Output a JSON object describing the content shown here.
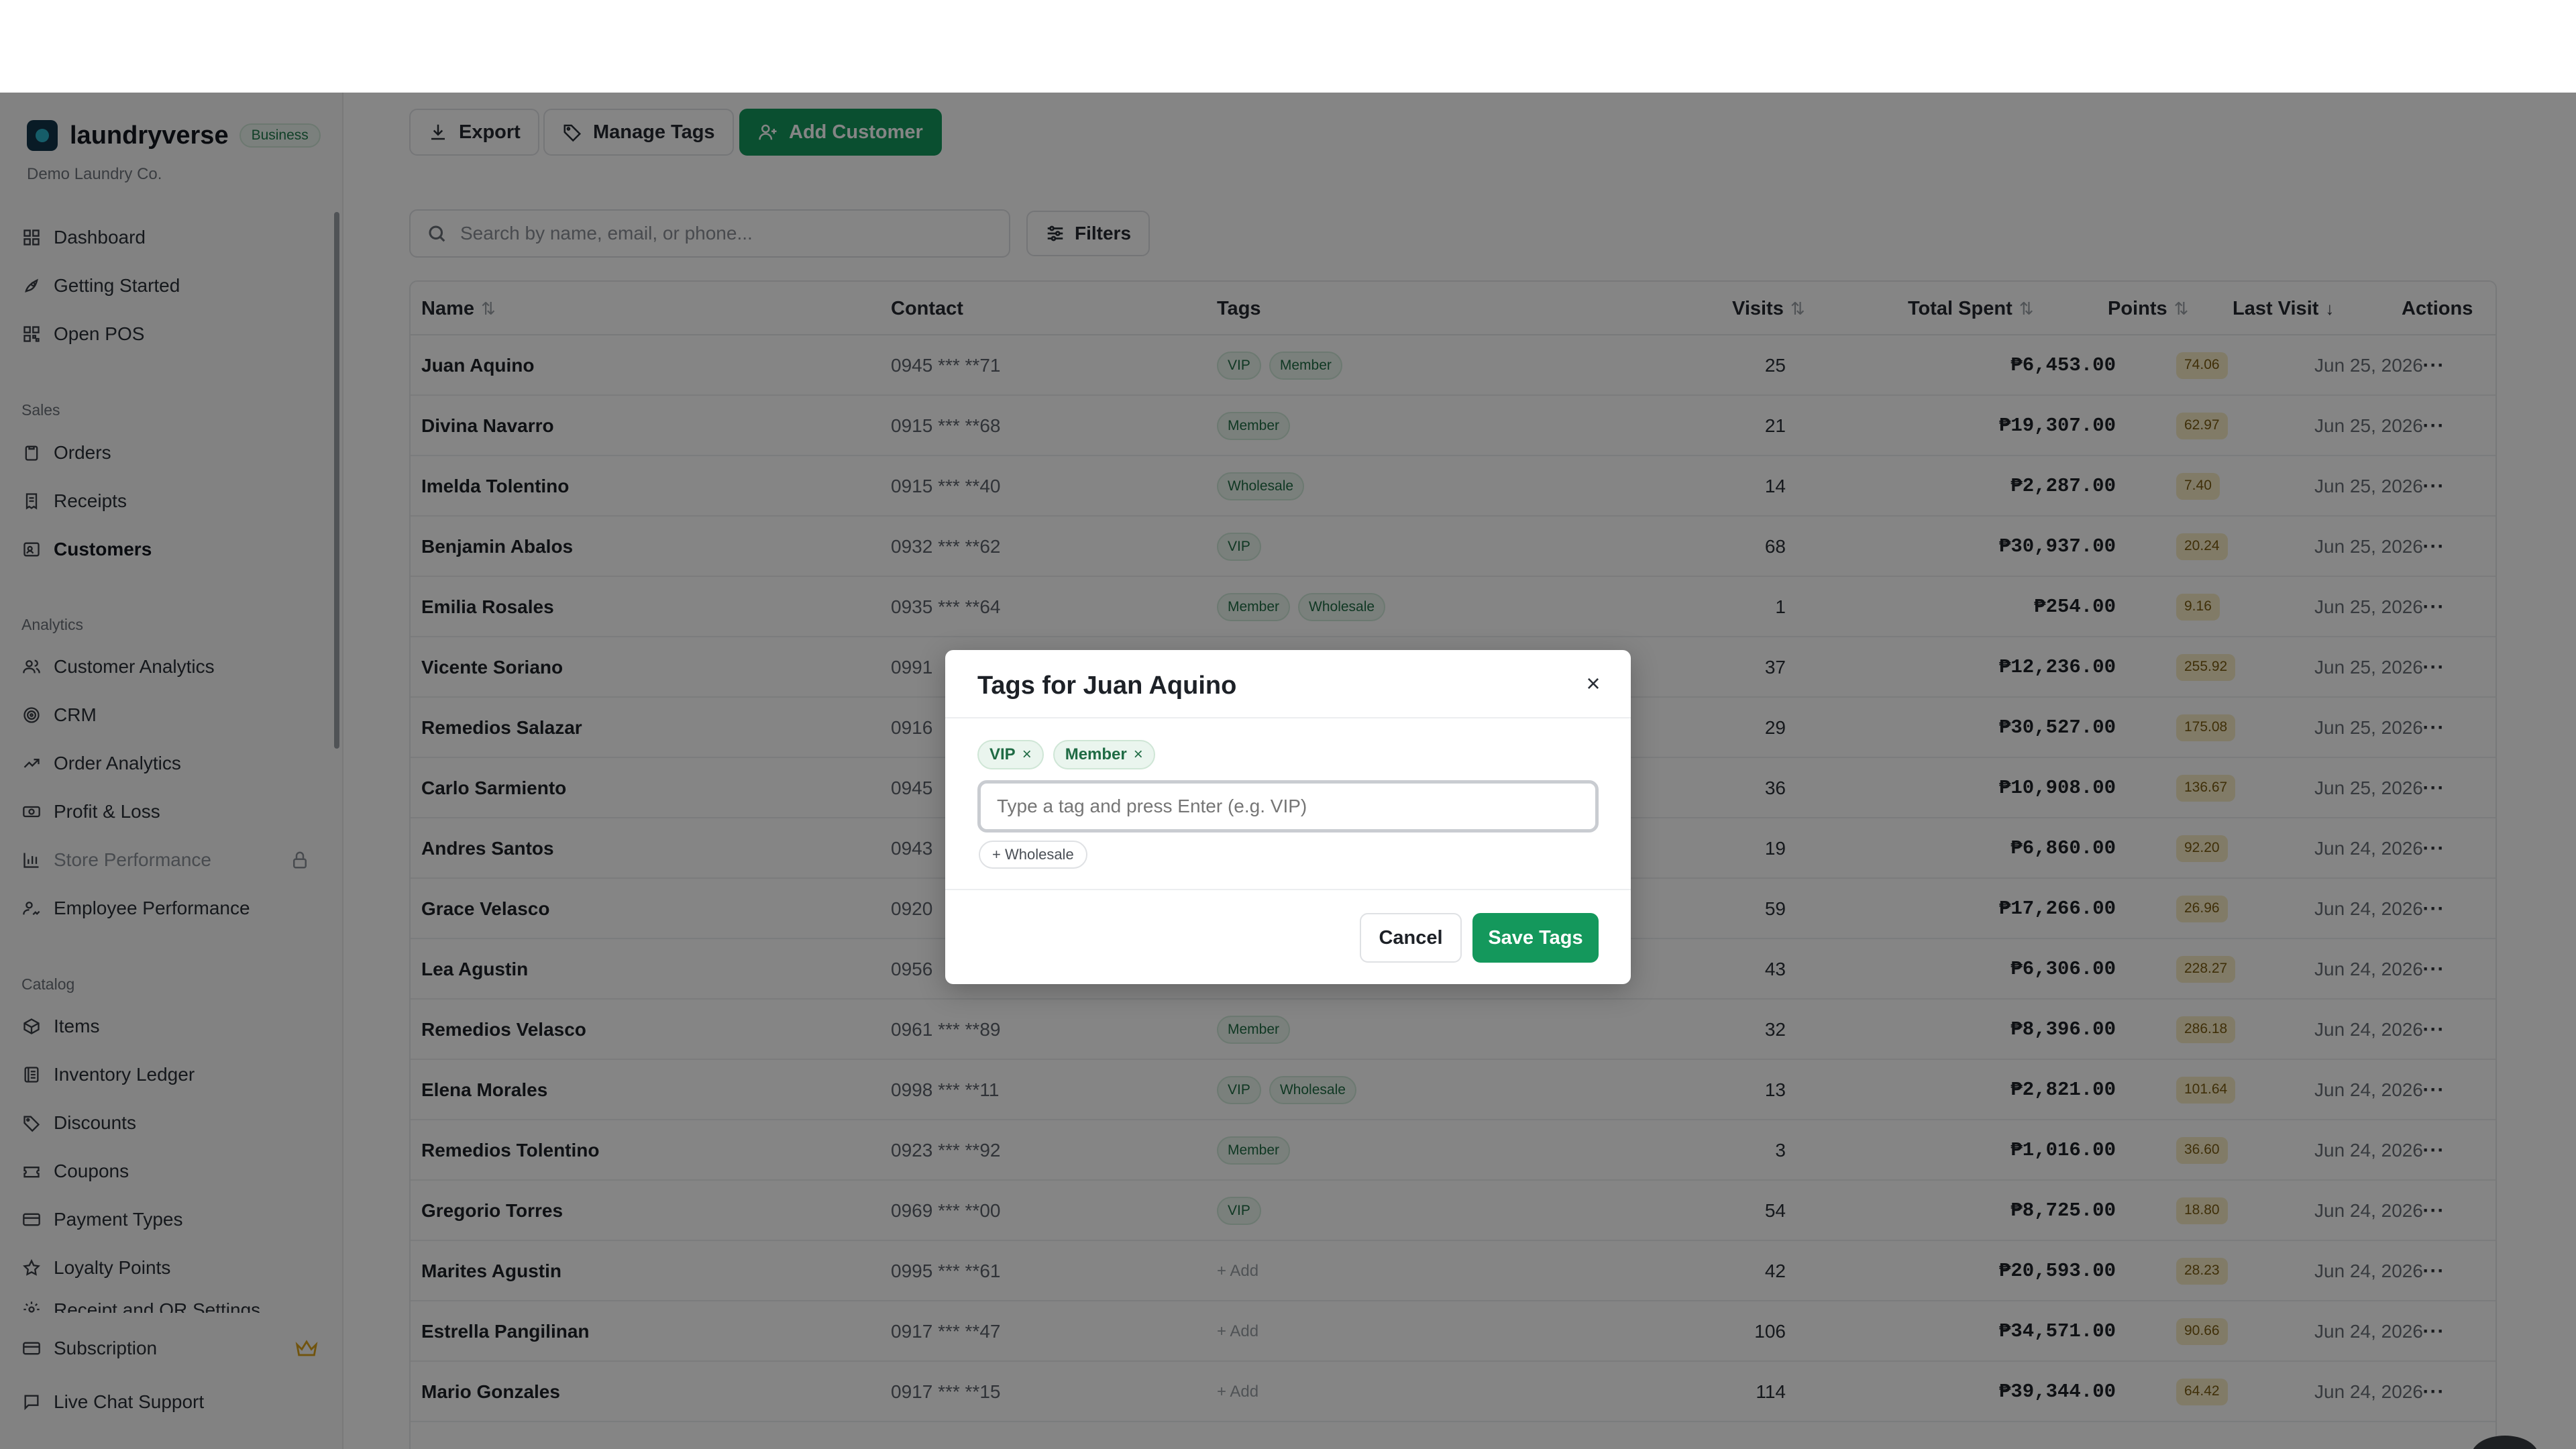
{
  "sidebar": {
    "brand_name": "laundryverse",
    "brand_badge": "Business",
    "company": "Demo Laundry Co.",
    "items_top": [
      {
        "label": "Dashboard",
        "icon": "grid-icon"
      },
      {
        "label": "Getting Started",
        "icon": "rocket-icon"
      },
      {
        "label": "Open POS",
        "icon": "qr-icon"
      }
    ],
    "sales_label": "Sales",
    "sales_items": [
      {
        "label": "Orders",
        "icon": "clipboard-icon"
      },
      {
        "label": "Receipts",
        "icon": "receipt-icon"
      },
      {
        "label": "Customers",
        "icon": "contact-icon"
      }
    ],
    "analytics_label": "Analytics",
    "analytics_items": [
      {
        "label": "Customer Analytics",
        "icon": "users-icon"
      },
      {
        "label": "CRM",
        "icon": "target-icon"
      },
      {
        "label": "Order Analytics",
        "icon": "trend-icon"
      },
      {
        "label": "Profit & Loss",
        "icon": "cash-icon"
      },
      {
        "label": "Store Performance",
        "icon": "bar-chart-icon"
      },
      {
        "label": "Employee Performance",
        "icon": "user-chart-icon"
      }
    ],
    "catalog_label": "Catalog",
    "catalog_items": [
      {
        "label": "Items",
        "icon": "package-icon"
      },
      {
        "label": "Inventory Ledger",
        "icon": "ledger-icon"
      },
      {
        "label": "Discounts",
        "icon": "tag-icon"
      },
      {
        "label": "Coupons",
        "icon": "ticket-icon"
      },
      {
        "label": "Payment Types",
        "icon": "card-icon"
      },
      {
        "label": "Loyalty Points",
        "icon": "star-icon"
      },
      {
        "label": "Receipt and QR Settings",
        "icon": "settings-icon"
      }
    ],
    "bottom_items": [
      {
        "label": "Subscription",
        "icon": "card-icon"
      },
      {
        "label": "Live Chat Support",
        "icon": "chat-icon"
      }
    ]
  },
  "toolbar": {
    "export": "Export",
    "manage_tags": "Manage Tags",
    "add_customer": "Add Customer"
  },
  "search": {
    "placeholder": "Search by name, email, or phone...",
    "filters": "Filters"
  },
  "table": {
    "headers": {
      "name": "Name",
      "contact": "Contact",
      "tags": "Tags",
      "visits": "Visits",
      "total_spent": "Total Spent",
      "points": "Points",
      "last_visit": "Last Visit",
      "actions": "Actions"
    },
    "rows": [
      {
        "name": "Juan Aquino",
        "contact": "0945 *** **71",
        "tags": [
          "VIP",
          "Member"
        ],
        "visits": "25",
        "spent": "₱6,453.00",
        "points": "74.06",
        "last": "Jun 25, 2026"
      },
      {
        "name": "Divina Navarro",
        "contact": "0915 *** **68",
        "tags": [
          "Member"
        ],
        "visits": "21",
        "spent": "₱19,307.00",
        "points": "62.97",
        "last": "Jun 25, 2026"
      },
      {
        "name": "Imelda Tolentino",
        "contact": "0915 *** **40",
        "tags": [
          "Wholesale"
        ],
        "visits": "14",
        "spent": "₱2,287.00",
        "points": "7.40",
        "last": "Jun 25, 2026"
      },
      {
        "name": "Benjamin Abalos",
        "contact": "0932 *** **62",
        "tags": [
          "VIP"
        ],
        "visits": "68",
        "spent": "₱30,937.00",
        "points": "20.24",
        "last": "Jun 25, 2026"
      },
      {
        "name": "Emilia Rosales",
        "contact": "0935 *** **64",
        "tags": [
          "Member",
          "Wholesale"
        ],
        "visits": "1",
        "spent": "₱254.00",
        "points": "9.16",
        "last": "Jun 25, 2026"
      },
      {
        "name": "Vicente Soriano",
        "contact": "0991",
        "tags": [],
        "visits": "37",
        "spent": "₱12,236.00",
        "points": "255.92",
        "last": "Jun 25, 2026"
      },
      {
        "name": "Remedios Salazar",
        "contact": "0916",
        "tags": [],
        "visits": "29",
        "spent": "₱30,527.00",
        "points": "175.08",
        "last": "Jun 25, 2026"
      },
      {
        "name": "Carlo Sarmiento",
        "contact": "0945",
        "tags": [],
        "visits": "36",
        "spent": "₱10,908.00",
        "points": "136.67",
        "last": "Jun 25, 2026"
      },
      {
        "name": "Andres Santos",
        "contact": "0943",
        "tags": [],
        "visits": "19",
        "spent": "₱6,860.00",
        "points": "92.20",
        "last": "Jun 24, 2026"
      },
      {
        "name": "Grace Velasco",
        "contact": "0920",
        "tags": [],
        "visits": "59",
        "spent": "₱17,266.00",
        "points": "26.96",
        "last": "Jun 24, 2026"
      },
      {
        "name": "Lea Agustin",
        "contact": "0956",
        "tags": [],
        "visits": "43",
        "spent": "₱6,306.00",
        "points": "228.27",
        "last": "Jun 24, 2026"
      },
      {
        "name": "Remedios Velasco",
        "contact": "0961 *** **89",
        "tags": [
          "Member"
        ],
        "visits": "32",
        "spent": "₱8,396.00",
        "points": "286.18",
        "last": "Jun 24, 2026"
      },
      {
        "name": "Elena Morales",
        "contact": "0998 *** **11",
        "tags": [
          "VIP",
          "Wholesale"
        ],
        "visits": "13",
        "spent": "₱2,821.00",
        "points": "101.64",
        "last": "Jun 24, 2026"
      },
      {
        "name": "Remedios Tolentino",
        "contact": "0923 *** **92",
        "tags": [
          "Member"
        ],
        "visits": "3",
        "spent": "₱1,016.00",
        "points": "36.60",
        "last": "Jun 24, 2026"
      },
      {
        "name": "Gregorio Torres",
        "contact": "0969 *** **00",
        "tags": [
          "VIP"
        ],
        "visits": "54",
        "spent": "₱8,725.00",
        "points": "18.80",
        "last": "Jun 24, 2026"
      },
      {
        "name": "Marites Agustin",
        "contact": "0995 *** **61",
        "tags": [],
        "add": "+ Add",
        "visits": "42",
        "spent": "₱20,593.00",
        "points": "28.23",
        "last": "Jun 24, 2026"
      },
      {
        "name": "Estrella Pangilinan",
        "contact": "0917 *** **47",
        "tags": [],
        "add": "+ Add",
        "visits": "106",
        "spent": "₱34,571.00",
        "points": "90.66",
        "last": "Jun 24, 2026"
      },
      {
        "name": "Mario Gonzales",
        "contact": "0917 *** **15",
        "tags": [],
        "add": "+ Add",
        "visits": "114",
        "spent": "₱39,344.00",
        "points": "64.42",
        "last": "Jun 24, 2026"
      }
    ],
    "actions_glyph": "···"
  },
  "modal": {
    "title": "Tags for Juan Aquino",
    "chips": [
      "VIP",
      "Member"
    ],
    "input_placeholder": "Type a tag and press Enter (e.g. VIP)",
    "suggestion": "+ Wholesale",
    "cancel": "Cancel",
    "save": "Save Tags"
  },
  "colors": {
    "primary": "#14985c",
    "tag_bg": "#eaf5ee",
    "points_bg": "#f7ecc6"
  }
}
